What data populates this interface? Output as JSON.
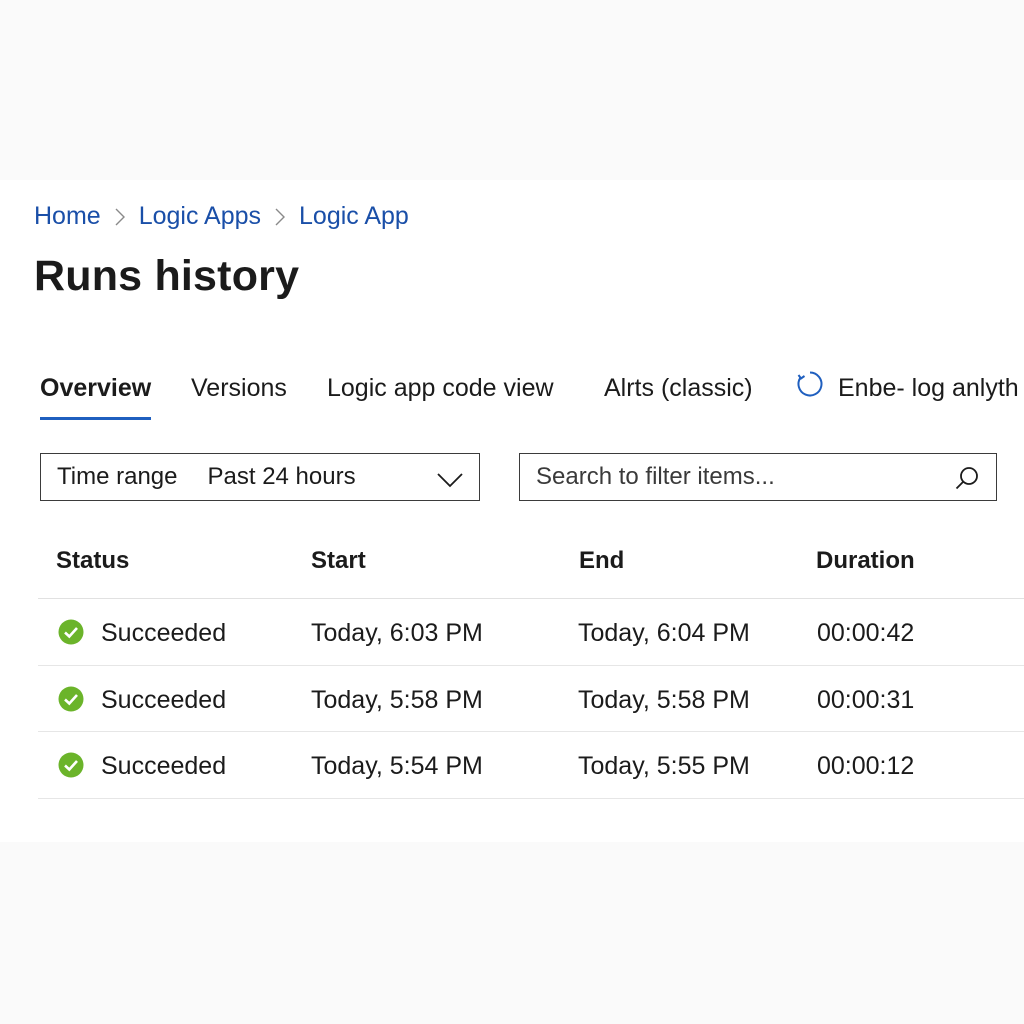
{
  "breadcrumb": {
    "items": [
      "Home",
      "Logic Apps",
      "Logic App"
    ]
  },
  "page": {
    "title": "Runs history"
  },
  "tabs": [
    {
      "label": "Overview",
      "active": true
    },
    {
      "label": "Versions",
      "active": false
    },
    {
      "label": "Logic app code view",
      "active": false
    },
    {
      "label": "Alrts (classic)",
      "active": false
    },
    {
      "label": "Enbe- log anlyth",
      "active": false,
      "icon": "refresh-circle-icon"
    }
  ],
  "filters": {
    "time_range_label": "Time range",
    "time_range_value": "Past 24 hours",
    "search_placeholder": "Search to filter items..."
  },
  "table": {
    "columns": [
      "Status",
      "Start",
      "End",
      "Duration"
    ],
    "rows": [
      {
        "status": "Succeeded",
        "start": "Today,  6:03  PM",
        "end": "Today, 6:04 PM",
        "duration": "00:00:42"
      },
      {
        "status": "Succeeded",
        "start": "Today,  5:58  PM",
        "end": "Today, 5:58 PM",
        "duration": "00:00:31"
      },
      {
        "status": "Succeeded",
        "start": "Today,  5:54  PM",
        "end": "Today, 5:55 PM",
        "duration": "00:00:12"
      }
    ]
  },
  "colors": {
    "link": "#1a4fa8",
    "accent": "#1f5fbf",
    "success": "#6bb42a",
    "text": "#1b1b1b"
  }
}
